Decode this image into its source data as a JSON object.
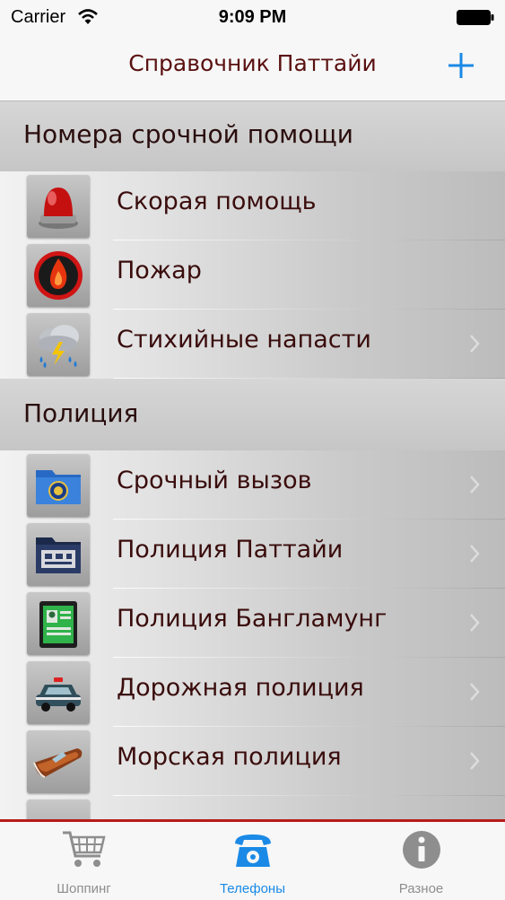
{
  "status_bar": {
    "carrier": "Carrier",
    "time": "9:09 PM"
  },
  "nav": {
    "title": "Справочник Паттайи",
    "add_icon": "plus-icon"
  },
  "sections": [
    {
      "header": "Номера срочной помощи",
      "items": [
        {
          "label": "Скорая помощь",
          "icon": "siren-icon"
        },
        {
          "label": "Пожар",
          "icon": "fire-icon"
        },
        {
          "label": "Стихийные напасти",
          "icon": "storm-icon"
        }
      ]
    },
    {
      "header": "Полиция",
      "items": [
        {
          "label": "Срочный вызов",
          "icon": "fbi-folder-icon"
        },
        {
          "label": "Полиция Паттайи",
          "icon": "police-folder-icon"
        },
        {
          "label": "Полиция Бангламунг",
          "icon": "id-card-icon"
        },
        {
          "label": "Дорожная полиция",
          "icon": "police-car-icon"
        },
        {
          "label": "Морская полиция",
          "icon": "boat-icon"
        }
      ]
    }
  ],
  "tabs": [
    {
      "label": "Шоппинг",
      "icon": "cart-icon",
      "active": false
    },
    {
      "label": "Телефоны",
      "icon": "phone-icon",
      "active": true
    },
    {
      "label": "Разное",
      "icon": "info-icon",
      "active": false
    }
  ],
  "colors": {
    "accent_blue": "#1a8ae6",
    "title_red": "#5a1010",
    "tab_border": "#b81a1a",
    "tab_inactive": "#8e8e8e"
  }
}
